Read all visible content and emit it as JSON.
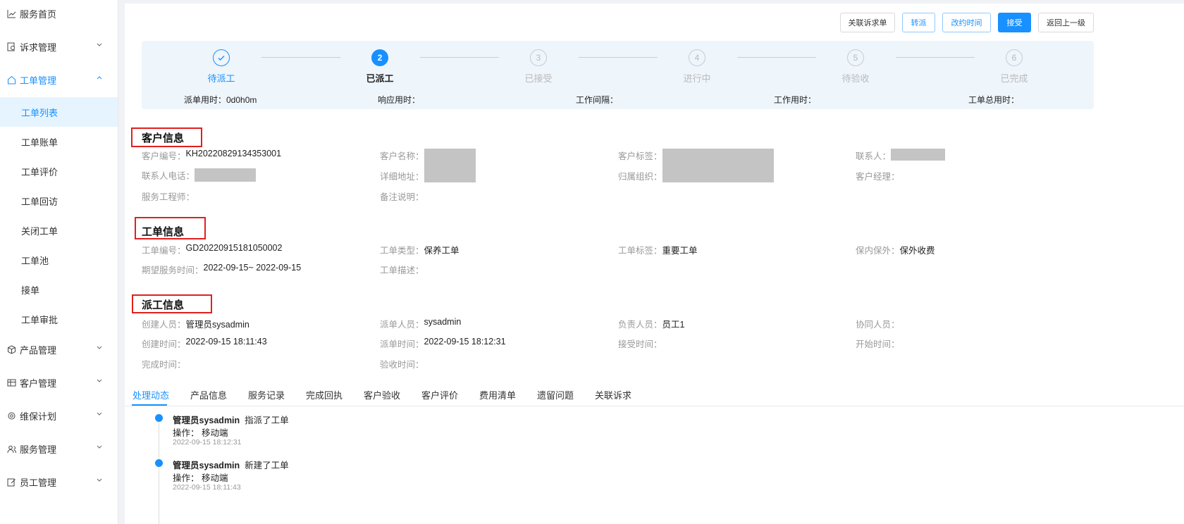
{
  "sidebar": {
    "groups": [
      {
        "label": "服务首页",
        "icon": "line-chart-icon"
      },
      {
        "label": "诉求管理",
        "icon": "file-search-icon"
      },
      {
        "label": "工单管理",
        "icon": "home-icon"
      },
      {
        "label": "产品管理",
        "icon": "cube-icon"
      },
      {
        "label": "客户管理",
        "icon": "table-icon"
      },
      {
        "label": "维保计划",
        "icon": "settings-icon"
      },
      {
        "label": "服务管理",
        "icon": "user-group-icon"
      },
      {
        "label": "员工管理",
        "icon": "edit-icon"
      }
    ],
    "sub_items": [
      "工单列表",
      "工单账单",
      "工单评价",
      "工单回访",
      "关闭工单",
      "工单池",
      "接单",
      "工单审批"
    ]
  },
  "toolbar": {
    "related_label": "关联诉求单",
    "transfer_label": "转派",
    "reschedule_label": "改约时间",
    "accept_label": "接受",
    "back_label": "返回上一级"
  },
  "steps": [
    {
      "num": "✓",
      "label": "待派工",
      "state": "done"
    },
    {
      "num": "2",
      "label": "已派工",
      "state": "current"
    },
    {
      "num": "3",
      "label": "已接受",
      "state": "pending"
    },
    {
      "num": "4",
      "label": "进行中",
      "state": "pending"
    },
    {
      "num": "5",
      "label": "待验收",
      "state": "pending"
    },
    {
      "num": "6",
      "label": "已完成",
      "state": "pending"
    }
  ],
  "metrics": {
    "dispatch_time": "派单用时：0d0h0m",
    "response_time": "响应用时：",
    "work_interval": "工作间隔：",
    "work_time": "工作用时：",
    "total_time": "工单总用时："
  },
  "customer": {
    "title": "客户信息",
    "code_label": "客户编号：",
    "code": "KH20220829134353001",
    "name_label": "客户名称：",
    "tag_label": "客户标签：",
    "contact_label": "联系人：",
    "phone_label": "联系人电话：",
    "address_label": "详细地址：",
    "org_label": "归属组织：",
    "manager_label": "客户经理：",
    "engineer_label": "服务工程师：",
    "remark_label": "备注说明："
  },
  "order": {
    "title": "工单信息",
    "code_label": "工单编号：",
    "code": "GD20220915181050002",
    "type_label": "工单类型：",
    "type": "保养工单",
    "tag_label": "工单标签：",
    "tag": "重要工单",
    "warranty_label": "保内保外：",
    "warranty": "保外收费",
    "expected_label": "期望服务时间：",
    "expected": "2022-09-15~ 2022-09-15",
    "desc_label": "工单描述："
  },
  "dispatch": {
    "title": "派工信息",
    "creator_label": "创建人员：",
    "creator": "管理员sysadmin",
    "dispatcher_label": "派单人员：",
    "dispatcher": "sysadmin",
    "owner_label": "负责人员：",
    "owner": "员工1",
    "assist_label": "协同人员：",
    "created_label": "创建时间：",
    "created": "2022-09-15 18:11:43",
    "dispatched_label": "派单时间：",
    "dispatched": "2022-09-15 18:12:31",
    "accepted_label": "接受时间：",
    "start_label": "开始时间：",
    "finish_label": "完成时间：",
    "check_label": "验收时间："
  },
  "tabs": [
    "处理动态",
    "产品信息",
    "服务记录",
    "完成回执",
    "客户验收",
    "客户评价",
    "费用清单",
    "遗留问题",
    "关联诉求"
  ],
  "timeline": [
    {
      "actor": "管理员sysadmin",
      "action": "指派了工单",
      "op": "操作： 移动端",
      "time": "2022-09-15 18:12:31"
    },
    {
      "actor": "管理员sysadmin",
      "action": "新建了工单",
      "op": "操作： 移动端",
      "time": "2022-09-15 18:11:43"
    }
  ],
  "colors": {
    "primary": "#1890ff",
    "highlight_box": "#e02020"
  }
}
